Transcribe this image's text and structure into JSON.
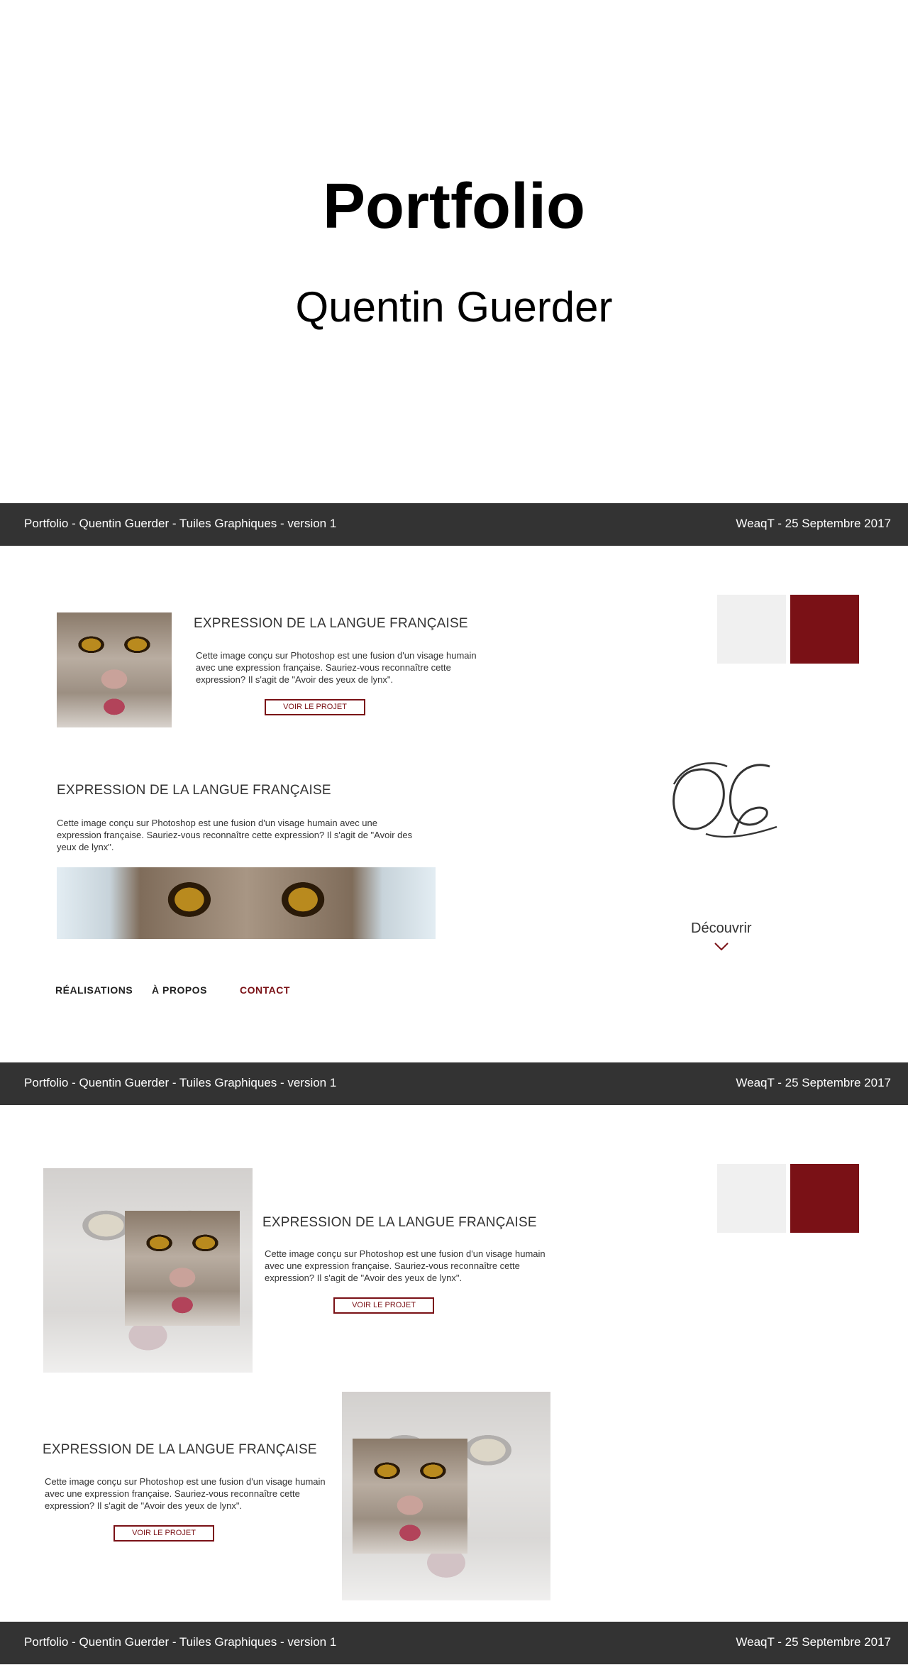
{
  "hero": {
    "title": "Portfolio",
    "subtitle": "Quentin Guerder"
  },
  "footer": {
    "left": "Portfolio - Quentin Guerder - Tuiles Graphiques - version 1",
    "right": "WeaqT - 25 Septembre 2017"
  },
  "colors": {
    "accent": "#7a1116",
    "bar": "#333333",
    "light": "#f0f0f0"
  },
  "section1": {
    "card1": {
      "title": "EXPRESSION DE LA LANGUE FRANÇAISE",
      "desc": "Cette image conçu sur Photoshop est une fusion d'un visage humain avec une expression française. Sauriez-vous reconnaître cette expression? Il s'agit de \"Avoir des yeux de lynx\".",
      "button": "VOIR LE PROJET"
    },
    "card2": {
      "title": "EXPRESSION DE LA LANGUE FRANÇAISE",
      "desc": "Cette image conçu sur Photoshop est une fusion d'un visage humain avec une expression française. Sauriez-vous reconnaître cette expression? Il s'agit de \"Avoir des yeux de lynx\"."
    },
    "logo_text": "QG",
    "discover": "Découvrir",
    "nav": [
      {
        "label": "RÉALISATIONS"
      },
      {
        "label": "À PROPOS"
      },
      {
        "label": "CONTACT"
      }
    ]
  },
  "section2": {
    "card1": {
      "title": "EXPRESSION DE LA LANGUE FRANÇAISE",
      "desc": "Cette image conçu sur Photoshop est une fusion d'un visage humain avec une expression française. Sauriez-vous reconnaître cette expression? Il s'agit de \"Avoir des yeux de lynx\".",
      "button": "VOIR LE PROJET"
    },
    "card2": {
      "title": "EXPRESSION DE LA LANGUE FRANÇAISE",
      "desc": "Cette image conçu sur Photoshop est une fusion d'un visage humain avec une expression française. Sauriez-vous reconnaître cette expression? Il s'agit de \"Avoir des yeux de lynx\".",
      "button": "VOIR LE PROJET"
    }
  }
}
